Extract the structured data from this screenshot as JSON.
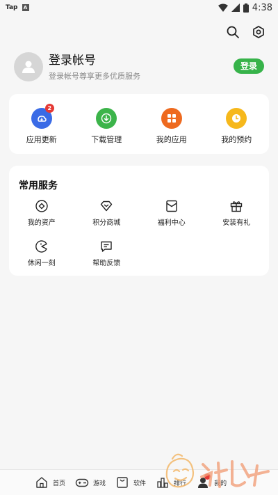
{
  "status_bar": {
    "carrier": "Tap",
    "app_badge": "A",
    "time": "4:38"
  },
  "top_icons": {
    "search": "search-icon",
    "settings": "settings-icon"
  },
  "profile": {
    "title": "登录帐号",
    "subtitle": "登录帐号尊享更多优质服务",
    "login_button": "登录"
  },
  "quick_actions": [
    {
      "label": "应用更新",
      "icon": "app-update-icon",
      "color": "#3a6be6",
      "badge": "2"
    },
    {
      "label": "下载管理",
      "icon": "download-icon",
      "color": "#3cb44a"
    },
    {
      "label": "我的应用",
      "icon": "my-apps-icon",
      "color": "#ee6a1f"
    },
    {
      "label": "我的预约",
      "icon": "reservation-icon",
      "color": "#f6b81c"
    }
  ],
  "services": {
    "title": "常用服务",
    "items": [
      {
        "label": "我的资产",
        "icon": "assets-icon"
      },
      {
        "label": "积分商城",
        "icon": "points-mall-icon"
      },
      {
        "label": "福利中心",
        "icon": "welfare-icon"
      },
      {
        "label": "安装有礼",
        "icon": "gift-icon"
      },
      {
        "label": "休闲一刻",
        "icon": "casual-game-icon"
      },
      {
        "label": "帮助反馈",
        "icon": "help-feedback-icon"
      }
    ]
  },
  "bottom_nav": [
    {
      "label": "首页",
      "icon": "home-icon"
    },
    {
      "label": "游戏",
      "icon": "gamepad-icon"
    },
    {
      "label": "软件",
      "icon": "software-bag-icon"
    },
    {
      "label": "排行",
      "icon": "ranking-icon"
    },
    {
      "label": "我的",
      "icon": "profile-icon",
      "active": true
    }
  ],
  "colors": {
    "accent_green": "#37b34a",
    "background": "#f6f6f6"
  }
}
